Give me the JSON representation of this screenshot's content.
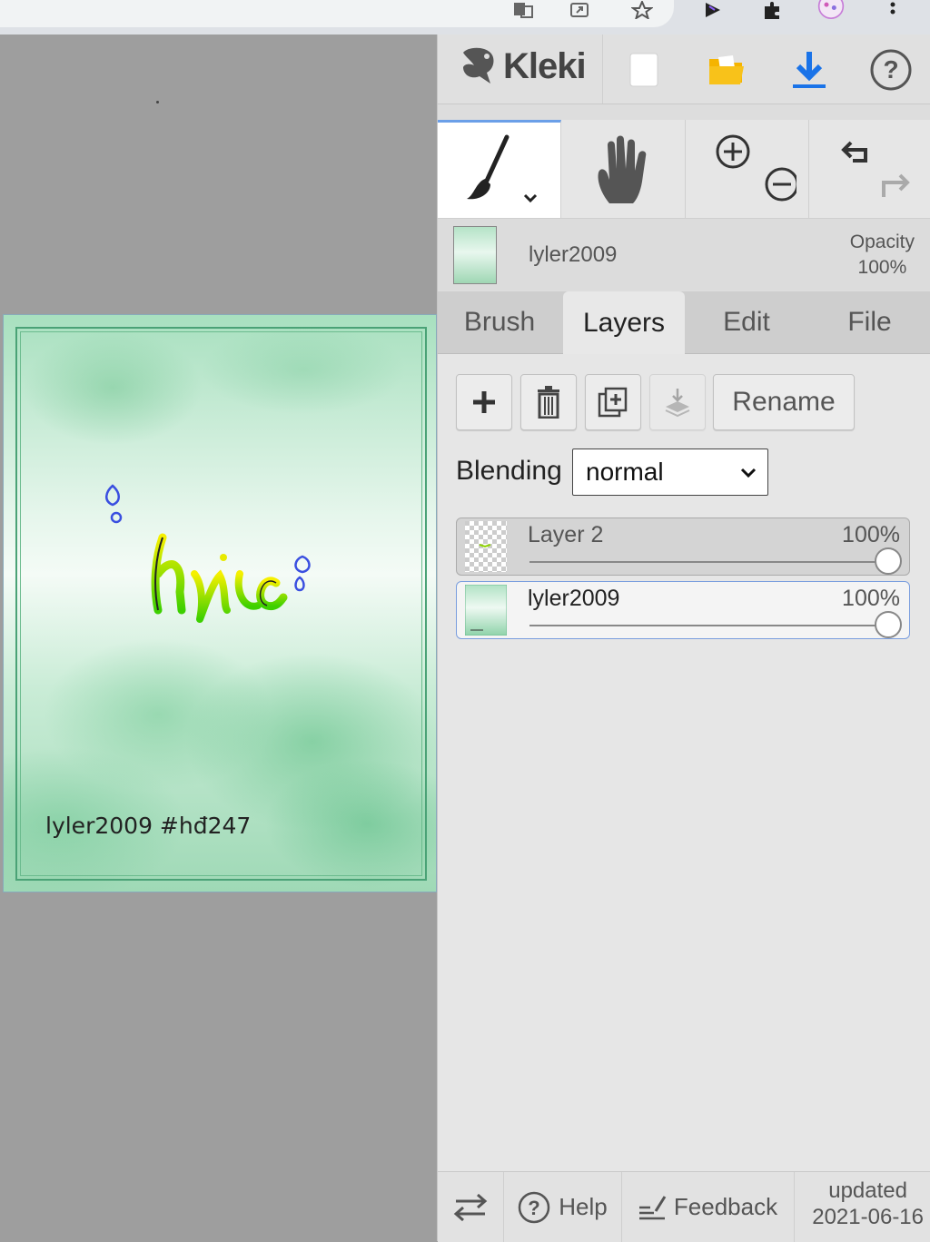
{
  "app": {
    "name": "Kleki"
  },
  "canvas": {
    "caption": "lyler2009 #hđ247",
    "script_text": "hic"
  },
  "layer_header": {
    "name": "lyler2009",
    "opacity_label": "Opacity",
    "opacity_value": "100%"
  },
  "tabs": [
    {
      "label": "Brush",
      "active": false
    },
    {
      "label": "Layers",
      "active": true
    },
    {
      "label": "Edit",
      "active": false
    },
    {
      "label": "File",
      "active": false
    }
  ],
  "layers_panel": {
    "rename_label": "Rename",
    "blending_label": "Blending",
    "blending_value": "normal",
    "layers": [
      {
        "name": "Layer 2",
        "opacity": "100%",
        "selected": false
      },
      {
        "name": "lyler2009",
        "opacity": "100%",
        "selected": true
      }
    ]
  },
  "bottom_bar": {
    "help_label": "Help",
    "feedback_label": "Feedback",
    "updated_label": "updated",
    "updated_date": "2021-06-16"
  },
  "colors": {
    "accent": "#6b9fe8",
    "download_blue": "#1a73e8",
    "folder_yellow": "#f5b400"
  }
}
